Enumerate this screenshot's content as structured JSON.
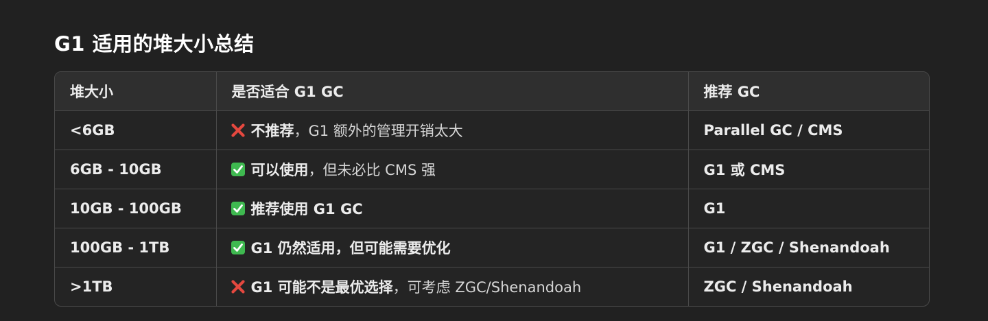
{
  "heading": "G1 适用的堆大小总结",
  "columns": [
    "堆大小",
    "是否适合 G1 GC",
    "推荐 GC"
  ],
  "rows": [
    {
      "size": "<6GB",
      "mark": "cross",
      "bold": "不推荐",
      "rest": "，G1 额外的管理开销太大",
      "gc": "Parallel GC / CMS"
    },
    {
      "size": "6GB - 10GB",
      "mark": "check",
      "bold": "可以使用",
      "rest": "，但未必比 CMS 强",
      "gc": "G1 或 CMS"
    },
    {
      "size": "10GB - 100GB",
      "mark": "check",
      "bold": "推荐使用 G1 GC",
      "rest": "",
      "gc": "G1"
    },
    {
      "size": "100GB - 1TB",
      "mark": "check",
      "bold": "G1 仍然适用，但可能需要优化",
      "rest": "",
      "gc": "G1 / ZGC / Shenandoah"
    },
    {
      "size": ">1TB",
      "mark": "cross",
      "bold": "G1 可能不是最优选择",
      "rest": "，可考虑 ZGC/Shenandoah",
      "gc": "ZGC / Shenandoah"
    }
  ],
  "colors": {
    "background": "#212121",
    "header_bg": "#2f2f2f",
    "border": "#4a4a4a",
    "check_green": "#3fb950",
    "cross_red": "#e5483f"
  },
  "icons": {
    "check": "check-mark-button-icon",
    "cross": "cross-mark-icon"
  }
}
